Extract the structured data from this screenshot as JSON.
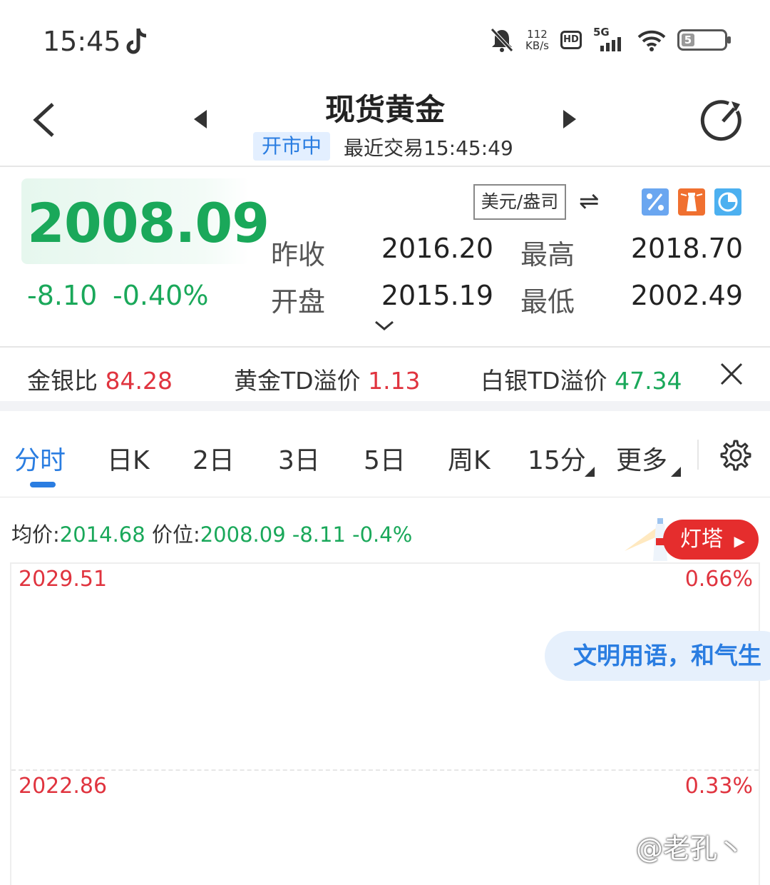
{
  "status_bar": {
    "time": "15:45",
    "net_speed": "112",
    "net_unit": "KB/s",
    "hd": "HD",
    "signal": "5G",
    "battery": "5"
  },
  "header": {
    "title": "现货黄金",
    "market_status": "开市中",
    "last_trade": "最近交易15:45:49"
  },
  "quote": {
    "price": "2008.09",
    "change": "-8.10",
    "change_pct": "-0.40%",
    "unit": "美元/盎司",
    "prev_close_label": "昨收",
    "prev_close": "2016.20",
    "high_label": "最高",
    "high": "2018.70",
    "open_label": "开盘",
    "open": "2015.19",
    "low_label": "最低",
    "low": "2002.49",
    "up_color": "#e0343f",
    "down_color": "#1aa85a"
  },
  "ratios": {
    "gold_silver_label": "金银比",
    "gold_silver": "84.28",
    "gold_td_label": "黄金TD溢价",
    "gold_td": "1.13",
    "silver_td_label": "白银TD溢价",
    "silver_td": "47.34"
  },
  "tabs": [
    "分时",
    "日K",
    "2日",
    "3日",
    "5日",
    "周K",
    "15分",
    "更多"
  ],
  "chart_header": {
    "avg_label": "均价:",
    "avg_value": "2014.68",
    "price_label": "价位:",
    "price_value": "2008.09",
    "change": "-8.11",
    "change_pct": "-0.4%",
    "lighthouse": "灯塔"
  },
  "chart": {
    "y_top": "2029.51",
    "y_top_pct": "0.66%",
    "y_mid": "2022.86",
    "y_mid_pct": "0.33%"
  },
  "overlay": {
    "bubble": "文明用语，和气生",
    "watermark": "@老孔丶"
  }
}
